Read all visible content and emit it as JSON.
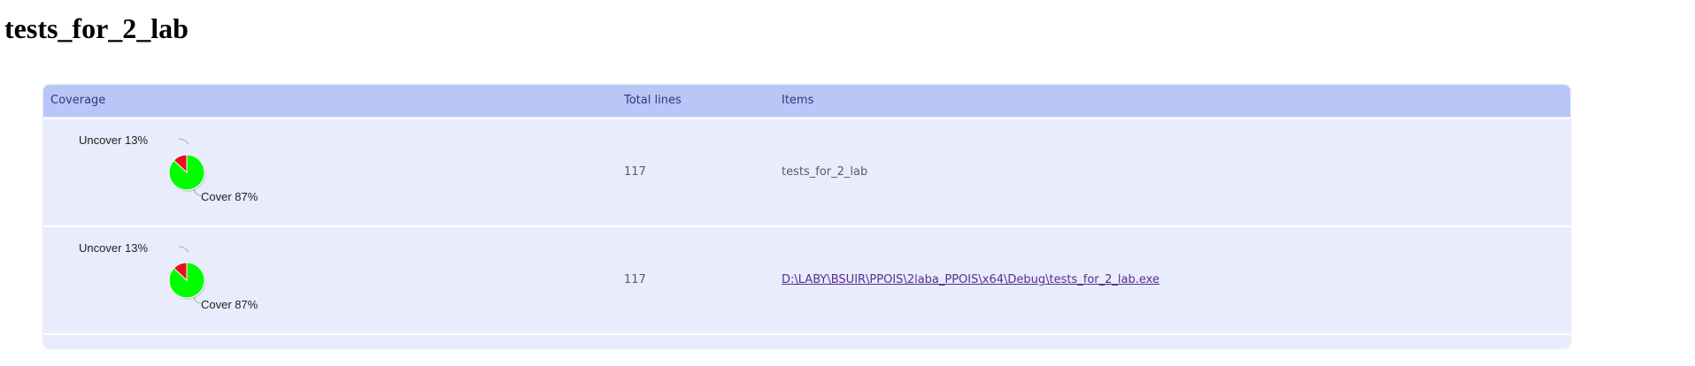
{
  "page": {
    "title": "tests_for_2_lab"
  },
  "table": {
    "headers": {
      "coverage": "Coverage",
      "total_lines": "Total lines",
      "items": "Items"
    },
    "rows": [
      {
        "uncover_label": "Uncover 13%",
        "cover_label": "Cover 87%",
        "cover_fraction": 0.87,
        "uncover_fraction": 0.13,
        "total_lines": "117",
        "item": "tests_for_2_lab",
        "is_link": false
      },
      {
        "uncover_label": "Uncover 13%",
        "cover_label": "Cover 87%",
        "cover_fraction": 0.87,
        "uncover_fraction": 0.13,
        "total_lines": "117",
        "item": "D:\\LABY\\BSUIR\\PPOIS\\2laba_PPOIS\\x64\\Debug\\tests_for_2_lab.exe",
        "is_link": true
      }
    ]
  },
  "colors": {
    "cover": "#00ff00",
    "uncover": "#e8101c",
    "header_bg": "#b8c6f8",
    "row_bg": "#e8ecfc",
    "link": "#5a2d8c"
  }
}
